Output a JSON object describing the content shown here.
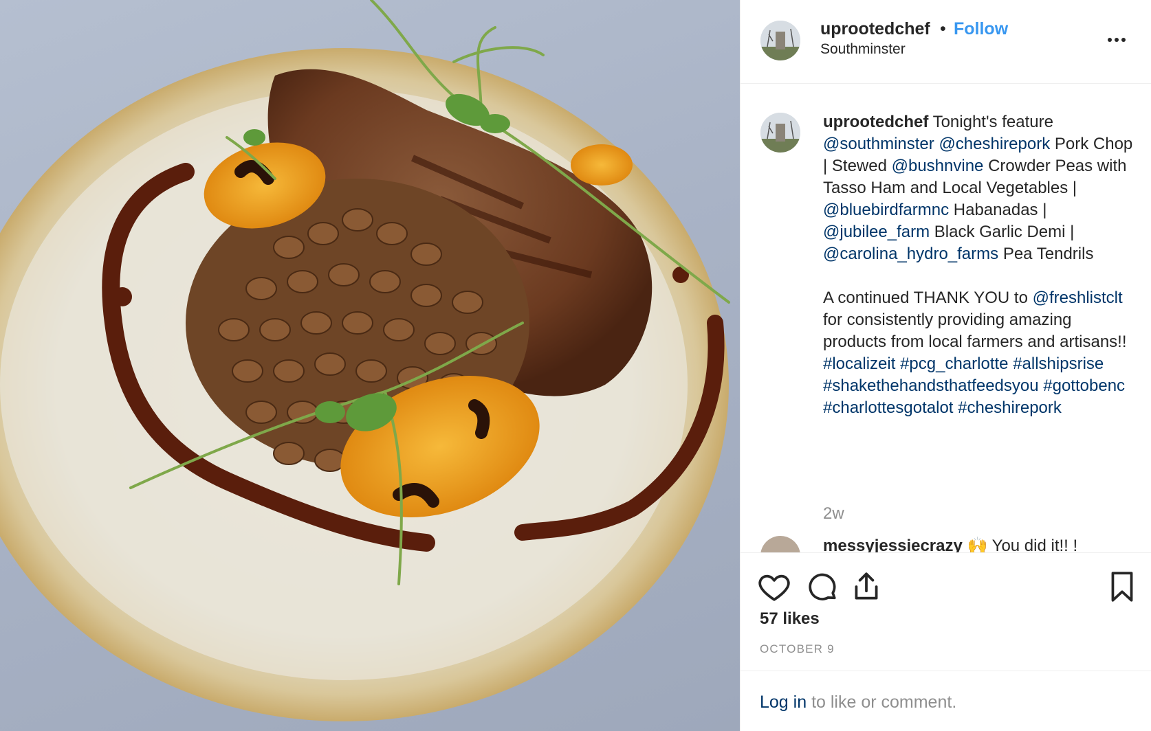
{
  "header": {
    "username": "uprootedchef",
    "separator": "•",
    "follow_label": "Follow",
    "location": "Southminster",
    "more_icon": "more-horizontal-icon"
  },
  "caption": {
    "username": "uprootedchef",
    "segments": [
      {
        "text": "Tonight's feature",
        "kind": "text"
      },
      {
        "text": "@southminster",
        "kind": "tag"
      },
      {
        "text": "@cheshirepork",
        "kind": "tag"
      },
      {
        "text": "Pork Chop | Stewed",
        "kind": "text"
      },
      {
        "text": "@bushnvine",
        "kind": "tag"
      },
      {
        "text": "Crowder Peas with Tasso Ham and Local Vegetables |",
        "kind": "text"
      },
      {
        "text": "@bluebirdfarmnc",
        "kind": "tag"
      },
      {
        "text": "Habanadas |",
        "kind": "text"
      },
      {
        "text": "@jubilee_farm",
        "kind": "tag"
      },
      {
        "text": "Black Garlic Demi |",
        "kind": "text"
      },
      {
        "text": "@carolina_hydro_farms",
        "kind": "tag"
      },
      {
        "text": "Pea Tendrils",
        "kind": "text"
      }
    ],
    "para2": [
      {
        "text": "A continued THANK YOU to",
        "kind": "text"
      },
      {
        "text": "@freshlistclt",
        "kind": "tag"
      },
      {
        "text": "for consistently providing amazing products from local farmers and artisans!!",
        "kind": "text"
      },
      {
        "text": "#localizeit",
        "kind": "tag"
      },
      {
        "text": "#pcg_charlotte",
        "kind": "tag"
      },
      {
        "text": "#allshipsrise",
        "kind": "tag"
      },
      {
        "text": "#shakethehandsthatfeedsyou",
        "kind": "tag"
      },
      {
        "text": "#gottobenc",
        "kind": "tag"
      },
      {
        "text": "#charlottesgotalot",
        "kind": "tag"
      },
      {
        "text": "#cheshirepork",
        "kind": "tag"
      }
    ],
    "time_ago": "2w"
  },
  "comment": {
    "username": "messyjessiecrazy",
    "emoji": "🙌",
    "text": "You did it!! !"
  },
  "actions": {
    "icons": [
      "heart-icon",
      "comment-icon",
      "share-icon",
      "bookmark-icon"
    ],
    "likes": "57 likes",
    "date": "OCTOBER 9"
  },
  "footer": {
    "login_link": "Log in",
    "login_rest": "to like or comment."
  },
  "colors": {
    "link": "#003569",
    "follow": "#3897f0",
    "muted": "#8e8e8e"
  }
}
